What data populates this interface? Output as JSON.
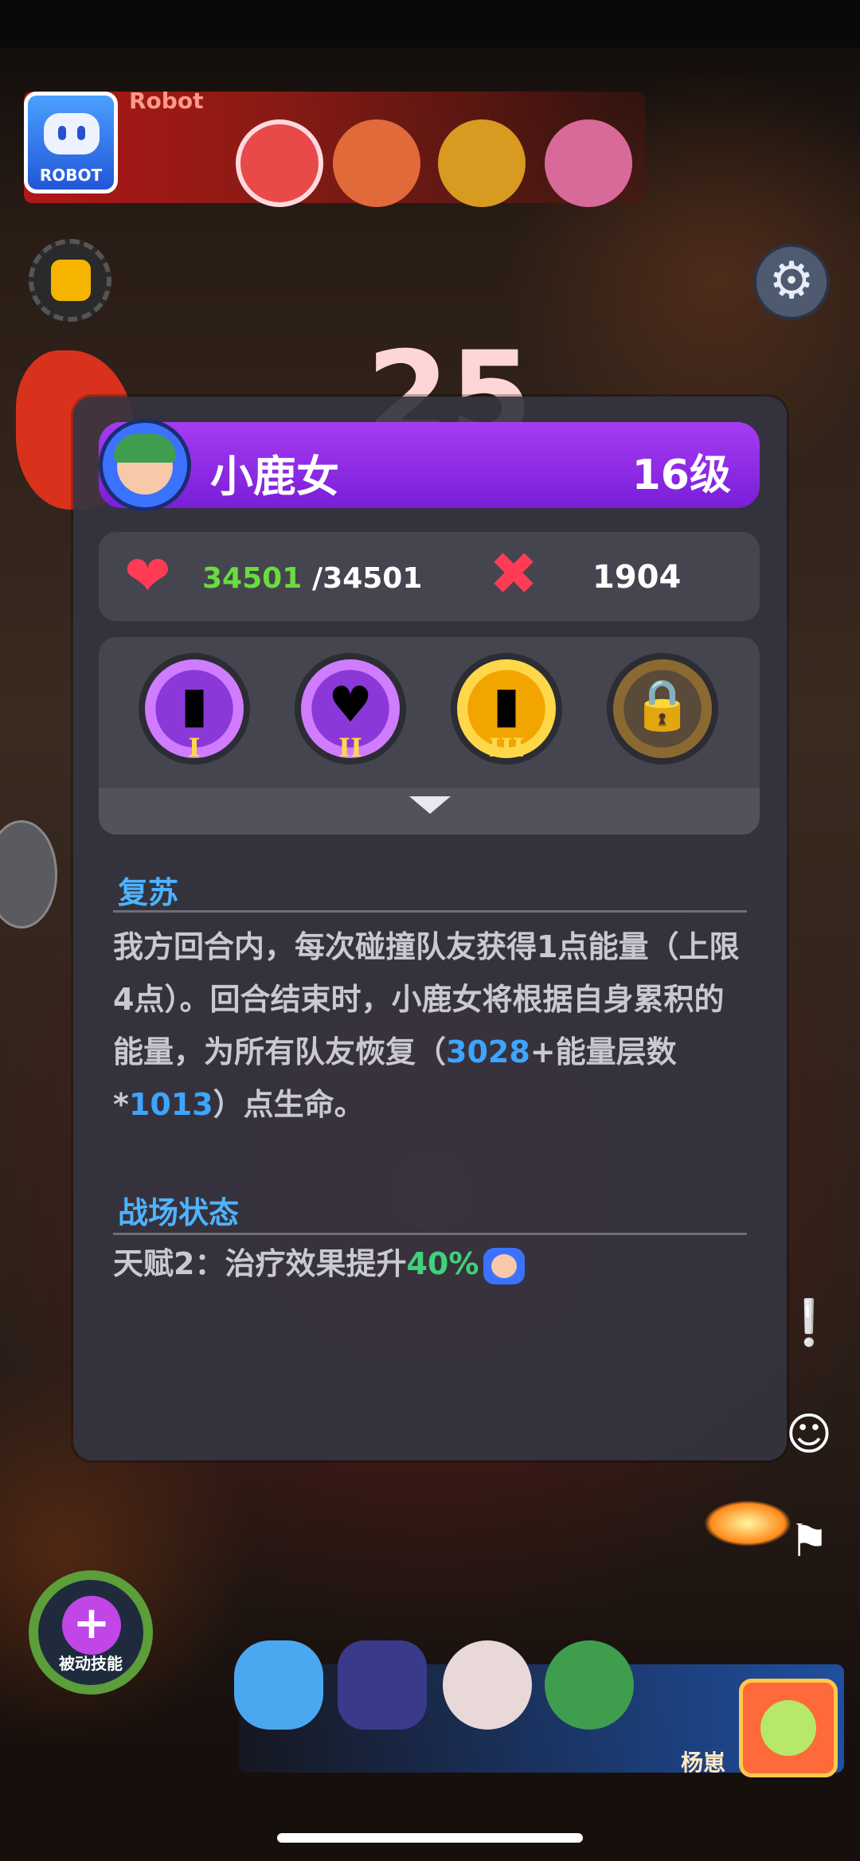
{
  "header": {
    "player_name": "Robot",
    "avatar_label": "ROBOT"
  },
  "panel": {
    "hero_name": "小鹿女",
    "hero_level": "16级",
    "hp_current": "34501",
    "hp_max": "/34501",
    "attack": "1904",
    "talents": [
      {
        "roman": "I",
        "icon": "battery-up-icon",
        "color": "#8a38d8",
        "ring": "#d07cff"
      },
      {
        "roman": "II",
        "icon": "heart-icon",
        "color": "#8a38d8",
        "ring": "#d07cff"
      },
      {
        "roman": "III",
        "icon": "battery-up-icon",
        "color": "#f2a500",
        "ring": "#ffd84a"
      },
      {
        "roman": "",
        "icon": "lock-icon",
        "color": "#5a4a3a",
        "ring": "#8a6a30"
      }
    ],
    "section1_title": "复苏",
    "desc_part1": "我方回合内，每次碰撞队友获得1点能量（上限4点）。回合结束时，小鹿女将根据自身累积的能量，为所有队友恢复（",
    "desc_hl1": "3028",
    "desc_part2": "+能量层数*",
    "desc_hl2": "1013",
    "desc_part3": "）点生命。",
    "section2_title": "战场状态",
    "status_prefix": "天赋2：治疗效果提升",
    "status_pct": "40%"
  },
  "bottom": {
    "passive_label": "被动技能",
    "self_name": "杨崽"
  },
  "colors": {
    "panel_bg": "#34343f",
    "name_bar": "#8e2ee6",
    "hp_green": "#6bdc3d",
    "highlight_blue": "#3ea5ff",
    "status_green": "#3fd27a"
  }
}
